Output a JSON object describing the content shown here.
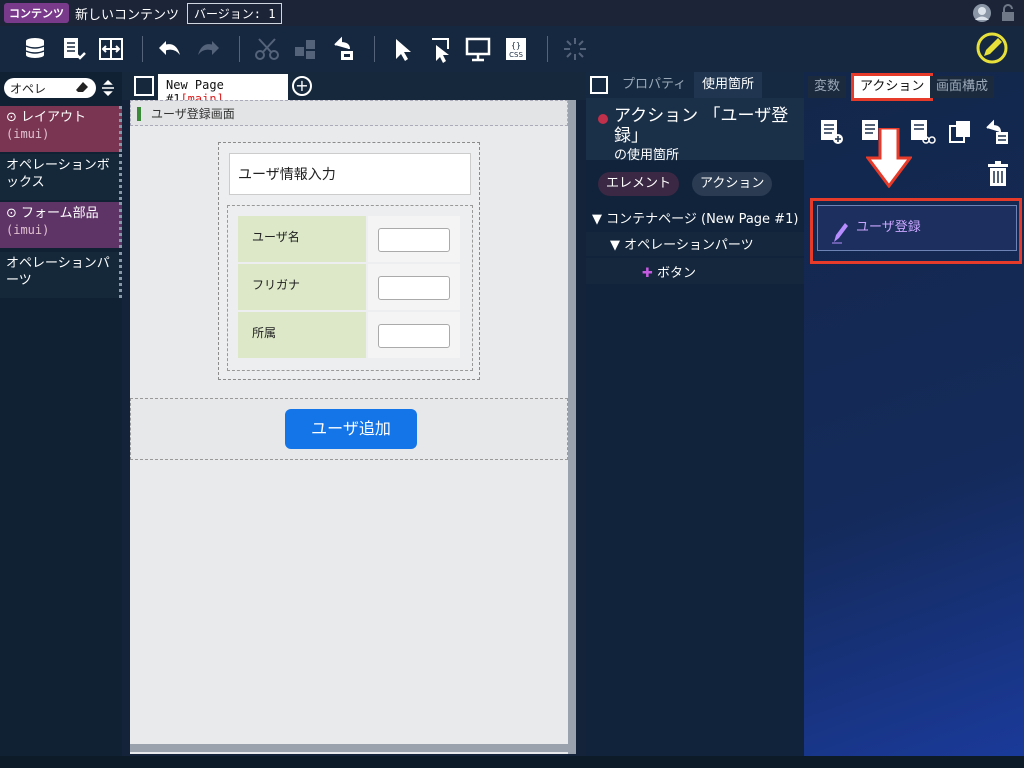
{
  "titlebar": {
    "badge": "コンテンツ",
    "title": "新しいコンテンツ",
    "version": "バージョン: 1"
  },
  "toolbar": {
    "icons": [
      "database-add-icon",
      "export-icon",
      "compare-icon",
      "undo-icon",
      "redo-icon",
      "cut-icon",
      "group-icon",
      "replace-icon",
      "select-icon",
      "inspect-icon",
      "preview-icon",
      "css-icon",
      "loading-icon",
      "edit-icon"
    ]
  },
  "palette": {
    "search_value": "オペレ",
    "categories": [
      {
        "label": "レイアウト",
        "sub": "(imui)"
      },
      {
        "label": "オペレーションボックス"
      },
      {
        "label": "フォーム部品",
        "sub": "(imui)"
      },
      {
        "label": "オペレーションパーツ"
      }
    ]
  },
  "canvas": {
    "tab_label": "New Page #1",
    "tab_tag": "[main]",
    "screen_label": "ユーザ登録画面",
    "form_title": "ユーザ情報入力",
    "fields": [
      "ユーザ名",
      "フリガナ",
      "所属"
    ],
    "button_label": "ユーザ追加"
  },
  "props": {
    "tabs": [
      "プロパティ",
      "使用箇所"
    ],
    "heading_main": "アクション 「ユーザ登録」",
    "heading_sub": "の使用箇所",
    "pills": [
      "エレメント",
      "アクション"
    ],
    "tree": [
      {
        "label": "コンテナページ (New Page #1)"
      },
      {
        "label": "オペレーションパーツ"
      },
      {
        "label": "ボタン"
      }
    ]
  },
  "actions": {
    "tabs": [
      "変数",
      "アクション",
      "画面構成"
    ],
    "items": [
      "ユーザ登録"
    ]
  }
}
